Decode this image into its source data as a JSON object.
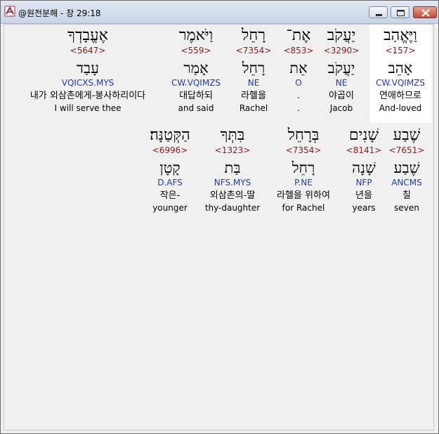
{
  "window": {
    "title": "@원전분해 - 창 29:18"
  },
  "rows": [
    [
      {
        "hebrew": "וַיֶּאֱהַב",
        "strong": "<157>",
        "lemma": "אָהֵב",
        "parse": "CW.VQIMZS",
        "korean": "연애하므로",
        "english": "And-loved"
      },
      {
        "hebrew": "יַעֲקֹב",
        "strong": "<3290>",
        "lemma": "יַעֲקֹב",
        "parse": "NE",
        "korean": "야곱이",
        "english": "Jacob"
      },
      {
        "hebrew": "אֶת־",
        "strong": "<853>",
        "lemma": "אֵת",
        "parse": "O",
        "korean": ".",
        "english": "."
      },
      {
        "hebrew": "רָחֵל",
        "strong": "<7354>",
        "lemma": "רָחֵל",
        "parse": "NE",
        "korean": "라헬을",
        "english": "Rachel"
      },
      {
        "hebrew": "וַיֹּאמֶר",
        "strong": "<559>",
        "lemma": "אָמַר",
        "parse": "CW.VQIMZS",
        "korean": "대답하되",
        "english": "and said"
      },
      {
        "hebrew": "אֶעֱבָדְךָ",
        "strong": "<5647>",
        "lemma": "עָבַד",
        "parse": "VQICXS.MYS",
        "korean": "내가 외삼촌에게-봉사하리이다",
        "english": "I will serve thee"
      }
    ],
    [
      {
        "hebrew": "שֶׁבַע",
        "strong": "<7651>",
        "lemma": "שֶׁבַע",
        "parse": "ANCMS",
        "korean": "칠",
        "english": "seven"
      },
      {
        "hebrew": "שָׁנִים",
        "strong": "<8141>",
        "lemma": "שָׁנָה",
        "parse": "NFP",
        "korean": "년을",
        "english": "years"
      },
      {
        "hebrew": "בְּרָחֵל",
        "strong": "<7354>",
        "lemma": "רָחֵל",
        "parse": "P.NE",
        "korean": "라헬을 위하여",
        "english": "for Rachel"
      },
      {
        "hebrew": "בִּתְּךָ",
        "strong": "<1323>",
        "lemma": "בַּת",
        "parse": "NFS.MYS",
        "korean": "외삼촌의-딸",
        "english": "thy-daughter"
      },
      {
        "hebrew": "הַקְּטַנָּה׃",
        "strong": "<6996>",
        "lemma": "קָטָן",
        "parse": "D.AFS",
        "korean": "작은-",
        "english": "younger"
      }
    ]
  ]
}
